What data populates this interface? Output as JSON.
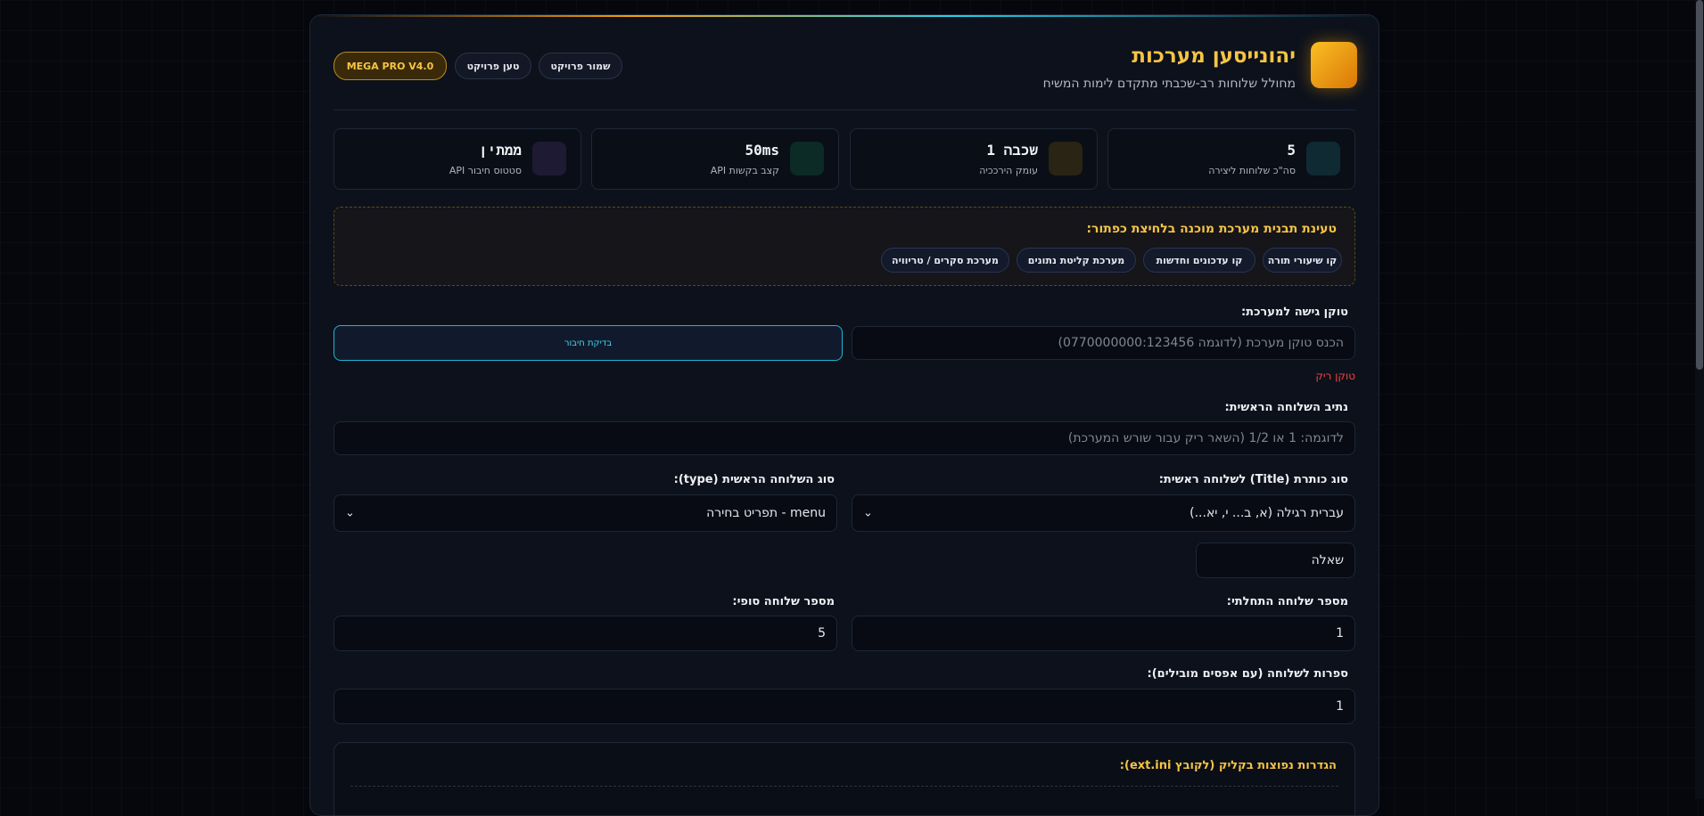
{
  "header": {
    "title": "יהונייסען מערכות",
    "subtitle": "מחולל שלוחות רב-שכבתי מתקדם לימות המשיח",
    "save_label": "שמור פרויקט",
    "load_label": "טען פרויקט",
    "version_badge": "MEGA PRO V4.0"
  },
  "stats": [
    {
      "value": "5",
      "label": "סה\"כ שלוחות ליצירה",
      "icon": "layers-icon",
      "color": "#0f2a33"
    },
    {
      "value": "שכבה 1",
      "label": "עומק הירככיה",
      "icon": "hierarchy-icon",
      "color": "#2a2414"
    },
    {
      "value": "50ms",
      "label": "קצב בקשות API",
      "icon": "speed-icon",
      "color": "#0c2a26"
    },
    {
      "value": "ממתין",
      "label": "סטטוס חיבור API",
      "icon": "plug-icon",
      "color": "#1f1a33"
    }
  ],
  "templates": {
    "title": "טעינת תבנית מערכת מוכנה בלחיצת כפתור:",
    "items": [
      "קו שיעורי תורה",
      "קו עדכונים וחדשות",
      "מערכת קליטת נתונים",
      "מערכת סקרים / טריוויה"
    ]
  },
  "token": {
    "label": "טוקן גישה למערכת:",
    "placeholder": "הכנס טוקן מערכת (לדוגמה 0770000000:123456)",
    "check_label": "בדיקת חיבור",
    "error": "טוקן ריק"
  },
  "path": {
    "label": "נתיב השלוחה הראשית:",
    "placeholder": "לדוגמה: 1 או 1/2 (השאר ריק עבור שורש המערכת)"
  },
  "title_type": {
    "label": "סוג כותרת (Title) לשלוחה ראשית:",
    "value": "עברית רגילה (א, ב... י, יא...)"
  },
  "ext_type": {
    "label": "סוג השלוחה הראשית (type):",
    "value": "menu - תפריט בחירה"
  },
  "title_word": {
    "value": "שאלה"
  },
  "start_num": {
    "label": "מספר שלוחה התחלתי:",
    "value": "1"
  },
  "end_num": {
    "label": "מספר שלוחה סופי:",
    "value": "5"
  },
  "digits": {
    "label": "ספרות לשלוחה (עם אפסים מובילים):",
    "value": "1"
  },
  "ext_settings": {
    "title": "הגדרות נפוצות בקליק (לקובץ ext.ini):"
  },
  "colors": {
    "accent": "#f6c445",
    "cyan": "#22d3ee",
    "error": "#ef4444"
  }
}
